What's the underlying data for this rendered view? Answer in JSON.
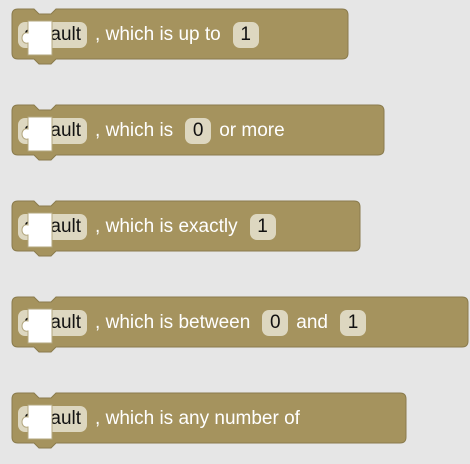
{
  "colors": {
    "workspace": "#e6e6e6",
    "block_fill": "#a5935e",
    "block_stroke": "#8a7b4d",
    "field_fill": "#ddd7c0"
  },
  "blocks": [
    {
      "name_field": "default",
      "parts": [
        {
          "kind": "text",
          "value": ", which is up to"
        },
        {
          "kind": "field",
          "value": "1"
        }
      ]
    },
    {
      "name_field": "default",
      "parts": [
        {
          "kind": "text",
          "value": ", which is"
        },
        {
          "kind": "field",
          "value": "0"
        },
        {
          "kind": "text",
          "value": "or more"
        }
      ]
    },
    {
      "name_field": "default",
      "parts": [
        {
          "kind": "text",
          "value": ", which is exactly"
        },
        {
          "kind": "field",
          "value": "1"
        }
      ]
    },
    {
      "name_field": "default",
      "parts": [
        {
          "kind": "text",
          "value": ", which is between"
        },
        {
          "kind": "field",
          "value": "0"
        },
        {
          "kind": "text",
          "value": "and"
        },
        {
          "kind": "field",
          "value": "1"
        }
      ]
    },
    {
      "name_field": "default",
      "parts": [
        {
          "kind": "text",
          "value": ", which is any number of"
        }
      ]
    }
  ]
}
